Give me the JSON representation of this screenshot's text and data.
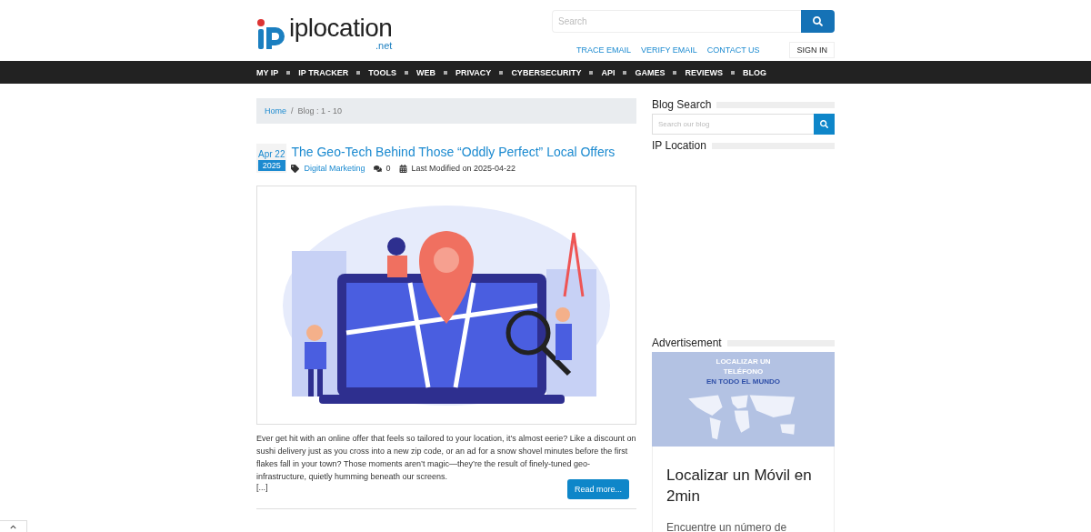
{
  "header": {
    "logo": {
      "brand": "iplocation",
      "tld": ".net"
    },
    "search": {
      "placeholder": "Search"
    },
    "links": [
      "TRACE EMAIL",
      "VERIFY EMAIL",
      "CONTACT US"
    ],
    "sign_in": "SIGN IN"
  },
  "nav": [
    "MY IP",
    "IP TRACKER",
    "TOOLS",
    "WEB",
    "PRIVACY",
    "CYBERSECURITY",
    "API",
    "GAMES",
    "REVIEWS",
    "BLOG"
  ],
  "breadcrumb": {
    "home": "Home",
    "separator": "/",
    "current": "Blog : 1 - 10"
  },
  "post": {
    "month_day": "Apr 22",
    "year": "2025",
    "title": "The Geo-Tech Behind Those “Oddly Perfect” Local Offers",
    "category": "Digital Marketing",
    "comments": "0",
    "modified": "Last Modified on 2025-04-22",
    "excerpt": "Ever get hit with an online offer that feels so tailored to your location, it’s almost eerie? Like a discount on sushi delivery just as you cross into a new zip code, or an ad for a snow shovel minutes before the first flakes fall in your town? Those moments aren’t magic—they’re the result of finely-tuned geo-infrastructure, quietly humming beneath our screens.",
    "ellipsis": "[...]",
    "read_more": "Read more..."
  },
  "sidebar": {
    "blog_search": {
      "heading": "Blog Search",
      "placeholder": "Search our blog"
    },
    "ip_location": {
      "heading": "IP Location"
    },
    "advertisement": {
      "heading": "Advertisement",
      "banner_lines": [
        "LOCALIZAR UN",
        "TELÉFONO",
        "EN TODO EL MUNDO"
      ],
      "title": "Localizar un Móvil en 2min",
      "text": "Encuentre un número de"
    }
  }
}
